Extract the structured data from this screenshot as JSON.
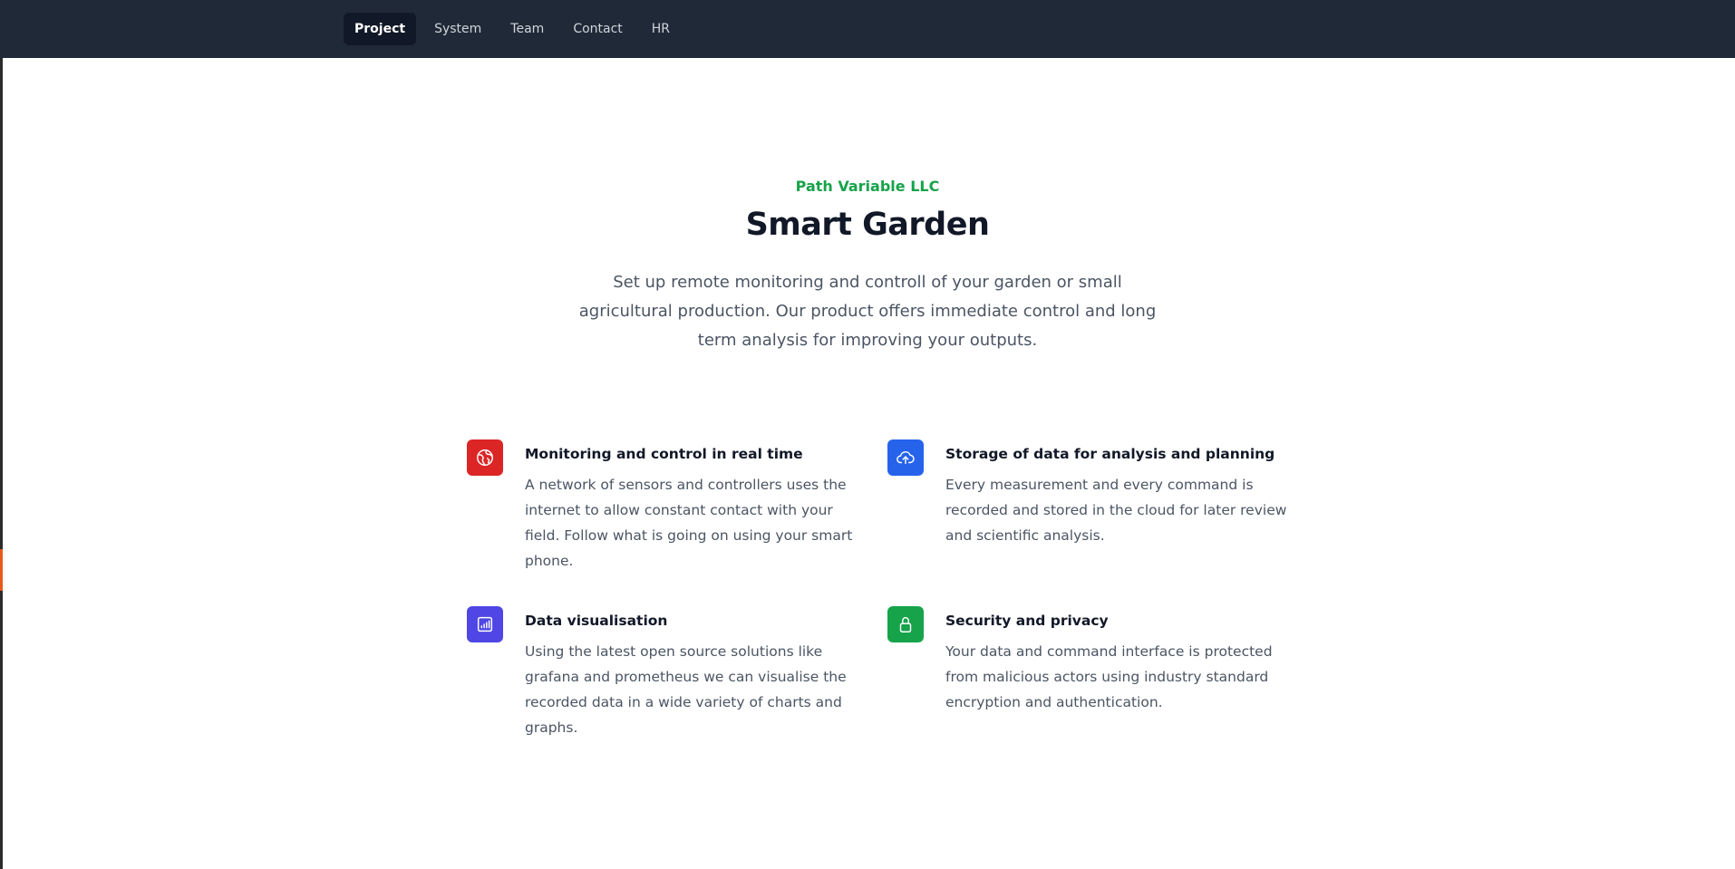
{
  "nav": {
    "items": [
      {
        "label": "Project",
        "active": true
      },
      {
        "label": "System",
        "active": false
      },
      {
        "label": "Team",
        "active": false
      },
      {
        "label": "Contact",
        "active": false
      },
      {
        "label": "HR",
        "active": false
      }
    ]
  },
  "hero": {
    "eyebrow": "Path Variable LLC",
    "title": "Smart Garden",
    "lead": "Set up remote monitoring and controll of your garden or small agricultural production. Our product offers immediate control and long term analysis for improving your outputs."
  },
  "features": [
    {
      "icon": "globe-icon",
      "color": "#dc2626",
      "title": "Monitoring and control in real time",
      "text": "A network of sensors and controllers uses the internet to allow constant contact with your field. Follow what is going on using your smart phone."
    },
    {
      "icon": "cloud-upload-icon",
      "color": "#2563eb",
      "title": "Storage of data for analysis and planning",
      "text": "Every measurement and every command is recorded and stored in the cloud for later review and scientific analysis."
    },
    {
      "icon": "chart-icon",
      "color": "#4f46e5",
      "title": "Data visualisation",
      "text": "Using the latest open source solutions like grafana and prometheus we can visualise the recorded data in a wide variety of charts and graphs."
    },
    {
      "icon": "lock-icon",
      "color": "#16a34a",
      "title": "Security and privacy",
      "text": "Your data and command interface is protected from malicious actors using industry standard encryption and authentication."
    }
  ]
}
